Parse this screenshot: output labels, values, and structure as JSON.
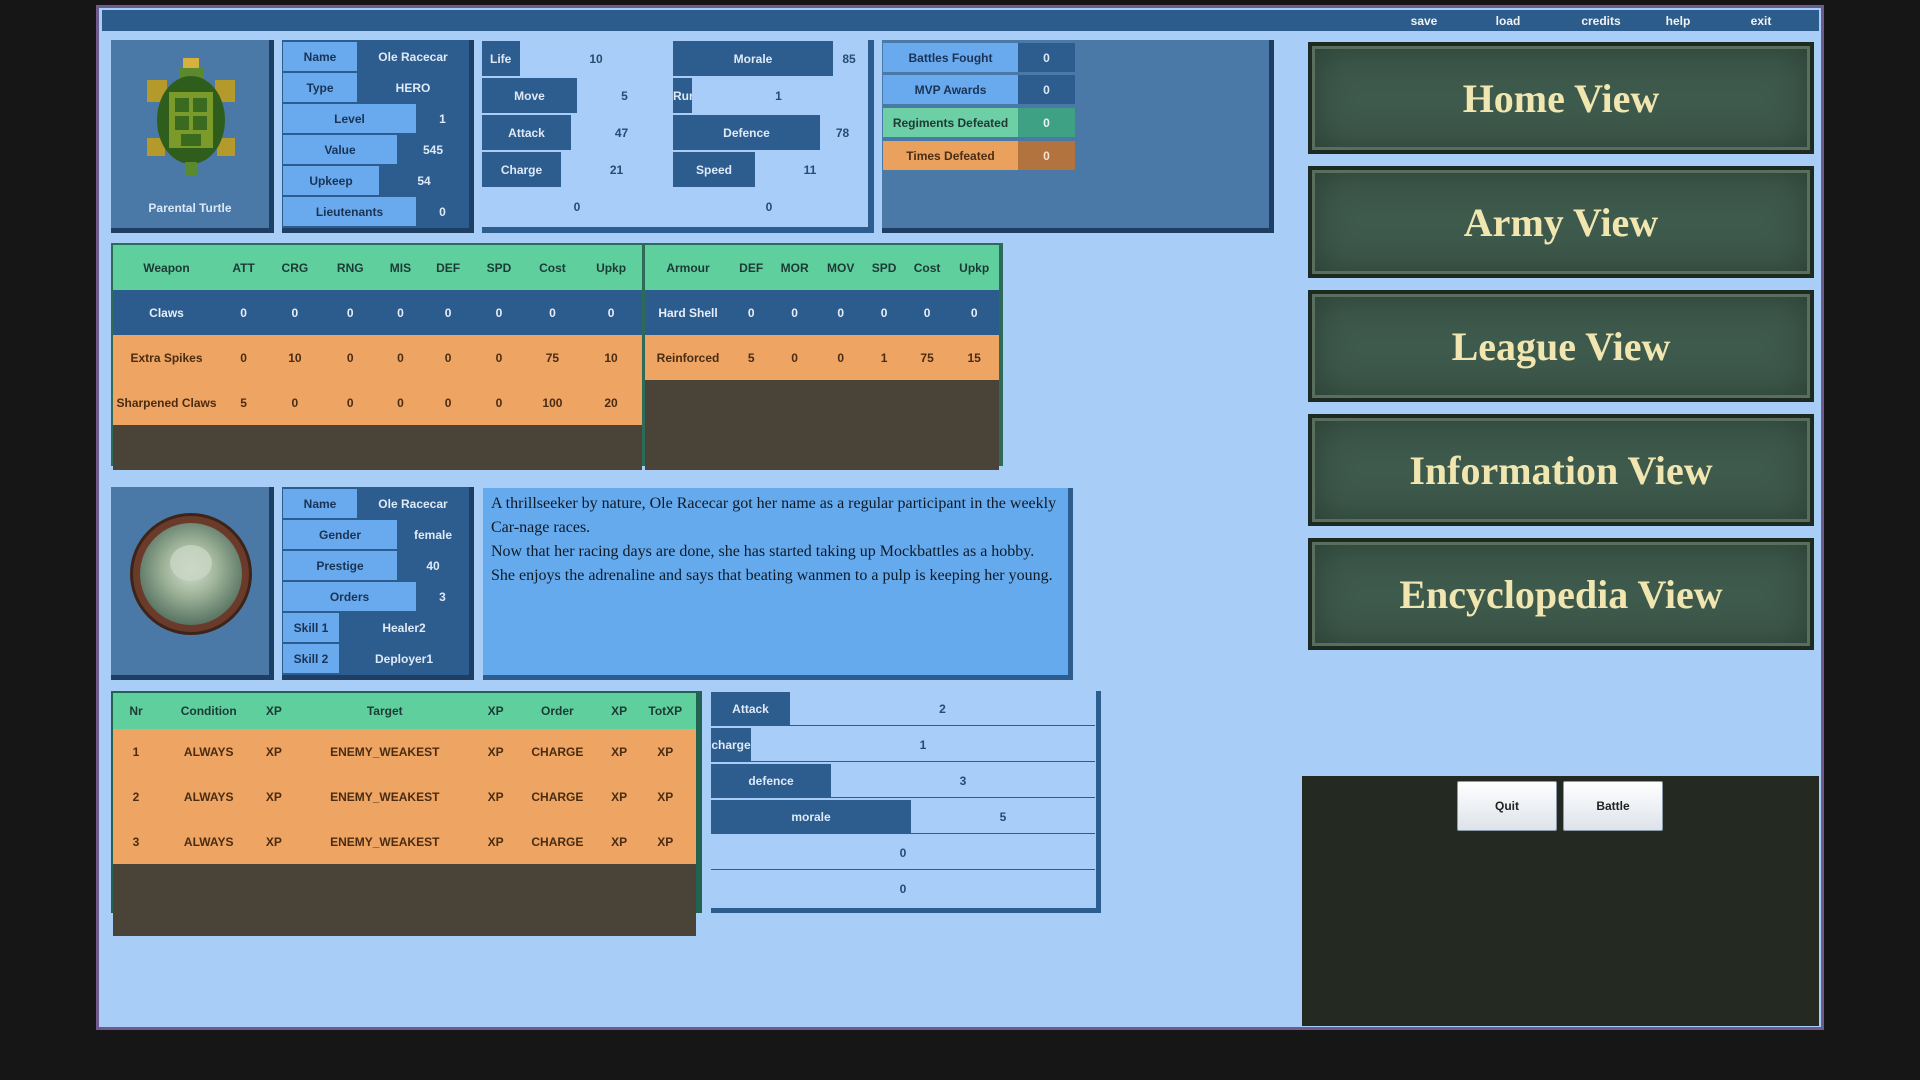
{
  "menu": [
    "save",
    "load",
    "credits",
    "help",
    "exit"
  ],
  "unit": {
    "name_label": "Name",
    "name": "Ole Racecar",
    "type_label": "Type",
    "type": "HERO",
    "level_label": "Level",
    "level": "1",
    "value_label": "Value",
    "value": "545",
    "upkeep_label": "Upkeep",
    "upkeep": "54",
    "lieutenants_label": "Lieutenants",
    "lieutenants": "0",
    "portrait_caption": "Parental Turtle"
  },
  "stats": {
    "life_label": "Life",
    "life": "10",
    "morale_label": "Morale",
    "morale": "85",
    "move_label": "Move",
    "move": "5",
    "run_label": "Run",
    "run": "1",
    "attack_label": "Attack",
    "attack": "47",
    "defence_label": "Defence",
    "defence": "78",
    "charge_label": "Charge",
    "charge": "21",
    "speed_label": "Speed",
    "speed": "11",
    "extra1": "0",
    "extra2": "0"
  },
  "record": {
    "battles_label": "Battles Fought",
    "battles": "0",
    "mvp_label": "MVP Awards",
    "mvp": "0",
    "regiments_label": "Regiments Defeated",
    "regiments": "0",
    "defeated_label": "Times Defeated",
    "defeated": "0"
  },
  "weapons": {
    "headers": [
      "Weapon",
      "ATT",
      "CRG",
      "RNG",
      "MIS",
      "DEF",
      "SPD",
      "Cost",
      "Upkp"
    ],
    "rows": [
      [
        "Claws",
        "0",
        "0",
        "0",
        "0",
        "0",
        "0",
        "0",
        "0"
      ],
      [
        "Extra Spikes",
        "0",
        "10",
        "0",
        "0",
        "0",
        "0",
        "75",
        "10"
      ],
      [
        "Sharpened Claws",
        "5",
        "0",
        "0",
        "0",
        "0",
        "0",
        "100",
        "20"
      ]
    ]
  },
  "armour": {
    "headers": [
      "Armour",
      "DEF",
      "MOR",
      "MOV",
      "SPD",
      "Cost",
      "Upkp"
    ],
    "rows": [
      [
        "Hard Shell",
        "0",
        "0",
        "0",
        "0",
        "0",
        "0"
      ],
      [
        "Reinforced",
        "5",
        "0",
        "0",
        "1",
        "75",
        "15"
      ]
    ]
  },
  "hero": {
    "name_label": "Name",
    "name": "Ole Racecar",
    "gender_label": "Gender",
    "gender": "female",
    "prestige_label": "Prestige",
    "prestige": "40",
    "orders_label": "Orders",
    "orders": "3",
    "skill1_label": "Skill 1",
    "skill1": "Healer2",
    "skill2_label": "Skill 2",
    "skill2": "Deployer1",
    "bio_1": "A thrillseeker by nature, Ole Racecar got her name as a regular participant in the weekly Car-nage races.",
    "bio_2": "Now that her racing days are done, she has started taking up Mockbattles as a hobby. She enjoys the adrenaline and says that beating wanmen to a pulp is keeping her young."
  },
  "orders": {
    "headers": [
      "Nr",
      "Condition",
      "XP",
      "Target",
      "XP",
      "Order",
      "XP",
      "TotXP"
    ],
    "rows": [
      [
        "1",
        "ALWAYS",
        "XP",
        "ENEMY_WEAKEST",
        "XP",
        "CHARGE",
        "XP",
        "XP"
      ],
      [
        "2",
        "ALWAYS",
        "XP",
        "ENEMY_WEAKEST",
        "XP",
        "CHARGE",
        "XP",
        "XP"
      ],
      [
        "3",
        "ALWAYS",
        "XP",
        "ENEMY_WEAKEST",
        "XP",
        "CHARGE",
        "XP",
        "XP"
      ]
    ]
  },
  "xp": {
    "attack_label": "Attack",
    "attack": "2",
    "charge_label": "charge",
    "charge": "1",
    "defence_label": "defence",
    "defence": "3",
    "morale_label": "morale",
    "morale": "5",
    "extra1": "0",
    "extra2": "0"
  },
  "views": [
    "Home View",
    "Army View",
    "League View",
    "Information View",
    "Encyclopedia View"
  ],
  "buttons": {
    "quit": "Quit",
    "battle": "Battle"
  }
}
